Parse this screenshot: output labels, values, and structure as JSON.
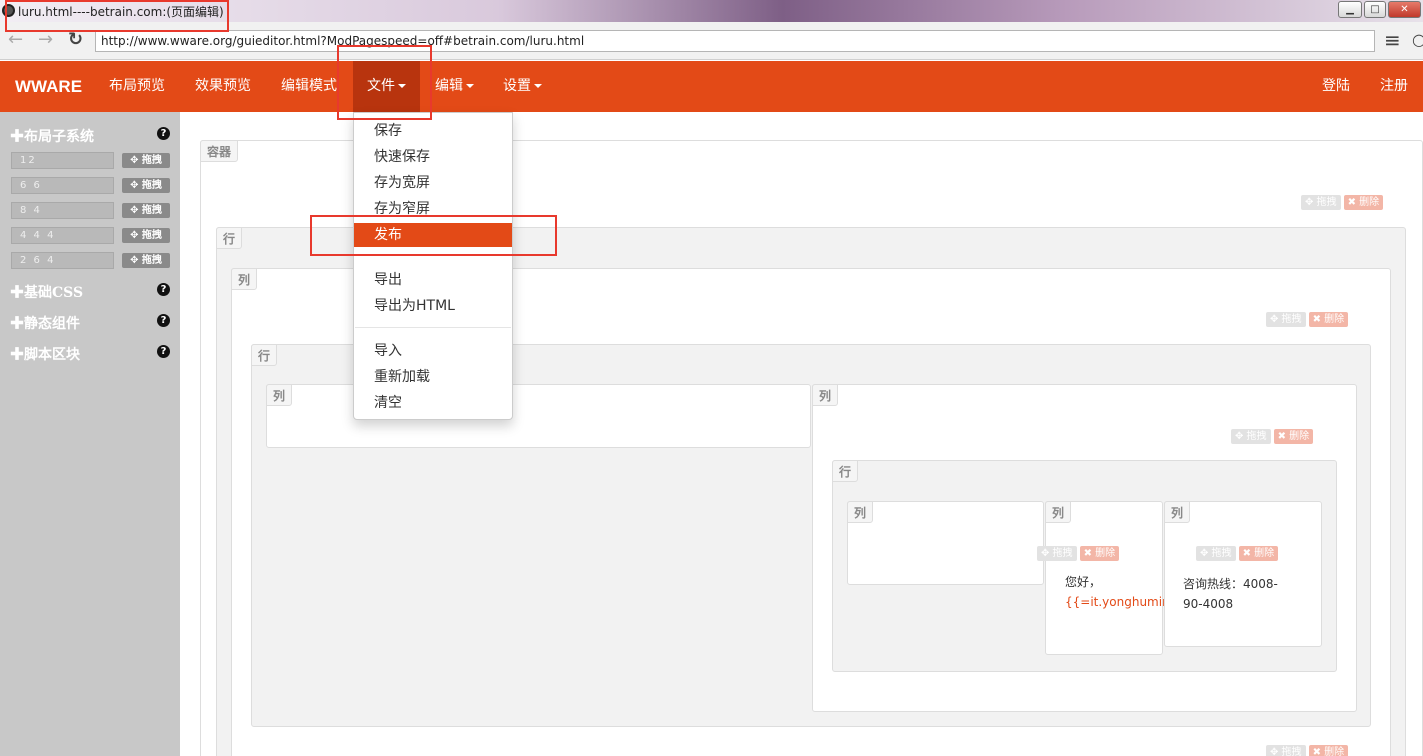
{
  "window": {
    "title": "luru.html----betrain.com:(页面编辑)",
    "minimize": "▁",
    "maximize": "□",
    "close": "✕"
  },
  "browser": {
    "back_glyph": "←",
    "forward_glyph": "→",
    "reload_glyph": "↻",
    "url": "http://www.wware.org/guieditor.html?ModPagespeed=off#betrain.com/luru.html",
    "menu_glyph": "≡"
  },
  "navbar": {
    "brand": "WWARE",
    "items": [
      "布局预览",
      "效果预览",
      "编辑模式",
      "文件",
      "编辑",
      "设置"
    ],
    "right": [
      "登陆",
      "注册"
    ],
    "color": "#e34a17",
    "active_color": "#b8340e"
  },
  "file_menu": {
    "group1": [
      "保存",
      "快速保存",
      "存为宽屏",
      "存为窄屏",
      "发布"
    ],
    "group2": [
      "导出",
      "导出为HTML"
    ],
    "group3": [
      "导入",
      "重新加载",
      "清空"
    ],
    "active_item": "发布"
  },
  "sidebar": {
    "sections": [
      "✚布局子系统",
      "✚基础CSS",
      "✚静态组件",
      "✚脚本区块"
    ],
    "help_glyph": "?",
    "rows": [
      {
        "value": "12",
        "drag": "✥ 拖拽"
      },
      {
        "value": "6 6",
        "drag": "✥ 拖拽"
      },
      {
        "value": "8 4",
        "drag": "✥ 拖拽"
      },
      {
        "value": "4 4 4",
        "drag": "✥ 拖拽"
      },
      {
        "value": "2 6 4",
        "drag": "✥ 拖拽"
      }
    ]
  },
  "editor": {
    "container_label": "容器",
    "row_label": "行",
    "col_label": "列",
    "drag_label": "✥ 拖拽",
    "delete_label": "✖ 删除",
    "text_greeting": "您好，",
    "text_template": "{{=it.yonghuming}}",
    "text_hotline": "咨询热线：4008-90-4008"
  }
}
